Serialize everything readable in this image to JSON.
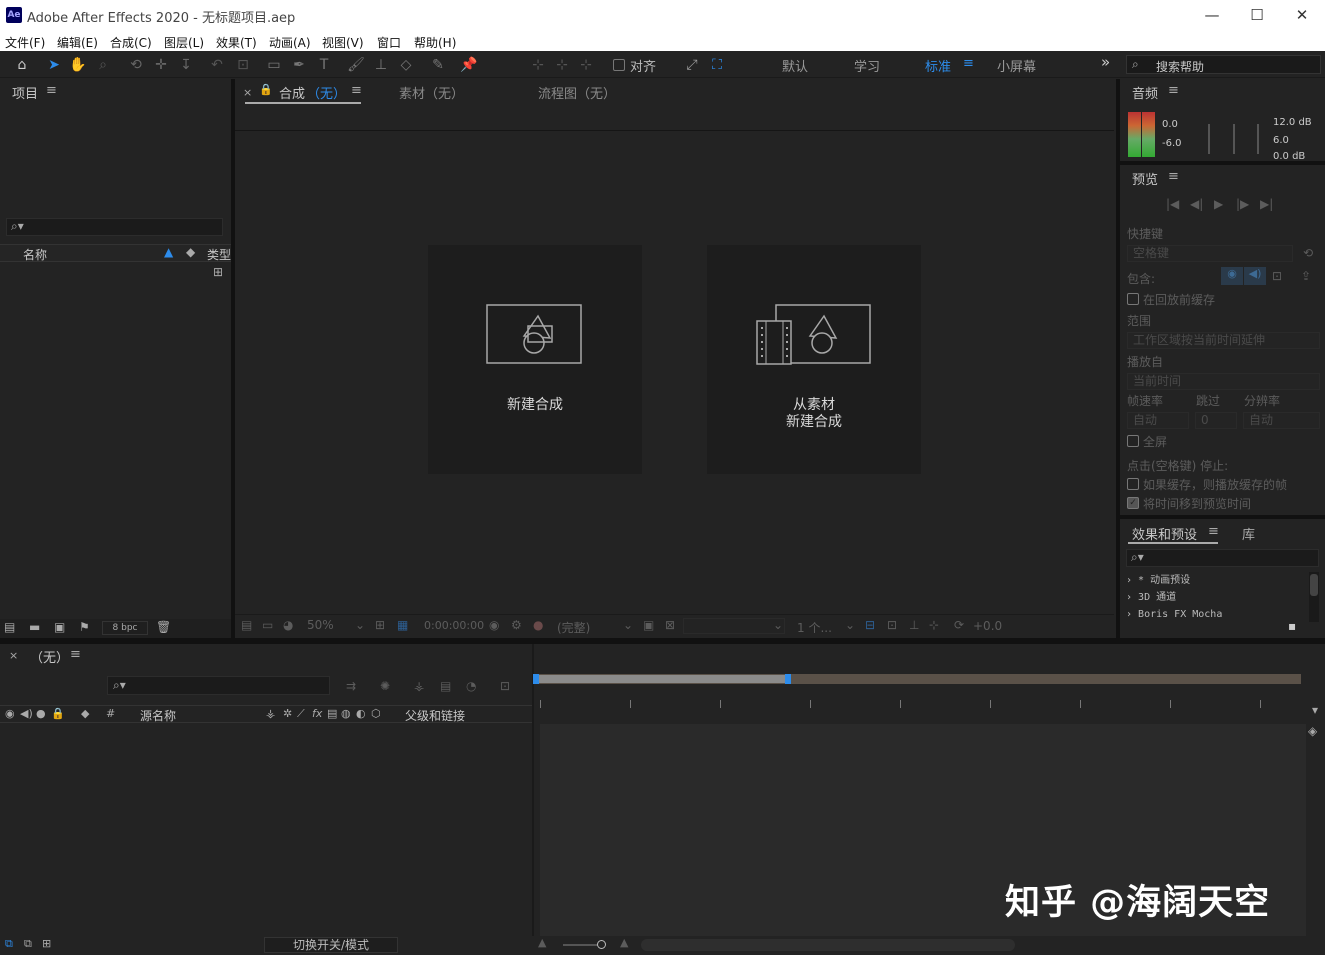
{
  "window": {
    "app_icon": "Ae",
    "title": "Adobe After Effects 2020 - 无标题项目.aep",
    "minimize": "—",
    "maximize": "☐",
    "close": "✕"
  },
  "menu": [
    "文件(F)",
    "编辑(E)",
    "合成(C)",
    "图层(L)",
    "效果(T)",
    "动画(A)",
    "视图(V)",
    "窗口",
    "帮助(H)"
  ],
  "toolbar": {
    "snap_label": "对齐",
    "workspaces": [
      "默认",
      "学习",
      "标准",
      "小屏幕"
    ],
    "active_workspace": "标准",
    "more": "»",
    "help_search_placeholder": "搜索帮助",
    "accent": "#2d8ceb"
  },
  "project_panel": {
    "title": "项目",
    "col_name": "名称",
    "col_type": "类型",
    "bpc": "8 bpc"
  },
  "comp_panel": {
    "tab_comp": "合成",
    "tab_comp_value": "（无）",
    "tab_footage": "素材（无）",
    "tab_flowchart": "流程图（无）",
    "new_comp": "新建合成",
    "from_footage_line1": "从素材",
    "from_footage_line2": "新建合成",
    "zoom": "50%",
    "timecode": "0:00:00:00",
    "resolution": "(完整)",
    "view": "1 个...",
    "exposure": "+0.0"
  },
  "audio_panel": {
    "title": "音频",
    "left_levels": [
      "0.0",
      "-6.0"
    ],
    "right_levels": [
      "12.0 dB",
      "6.0",
      "0.0 dB"
    ]
  },
  "preview_panel": {
    "title": "预览",
    "shortcut_label": "快捷键",
    "shortcut_value": "空格键",
    "include_label": "包含:",
    "cache_before": "在回放前缓存",
    "range_label": "范围",
    "range_value": "工作区域按当前时间延伸",
    "play_from_label": "播放自",
    "play_from_value": "当前时间",
    "framerate_label": "帧速率",
    "skip_label": "跳过",
    "resolution_label": "分辨率",
    "framerate_value": "自动",
    "skip_value": "0",
    "resolution_value": "自动",
    "fullscreen": "全屏",
    "stop_label": "点击(空格键) 停止:",
    "opt_cached": "如果缓存，则播放缓存的帧",
    "opt_move_time": "将时间移到预览时间"
  },
  "effects_panel": {
    "title": "效果和预设",
    "tab_library": "库",
    "items": [
      "* 动画预设",
      "3D 通道",
      "Boris FX Mocha"
    ]
  },
  "timeline": {
    "title": "（无）",
    "col_source": "源名称",
    "col_parent": "父级和链接",
    "col_hash": "#",
    "toggle_label": "切换开关/模式",
    "work_area_progress": 0.33
  },
  "watermark": "知乎 @海阔天空"
}
